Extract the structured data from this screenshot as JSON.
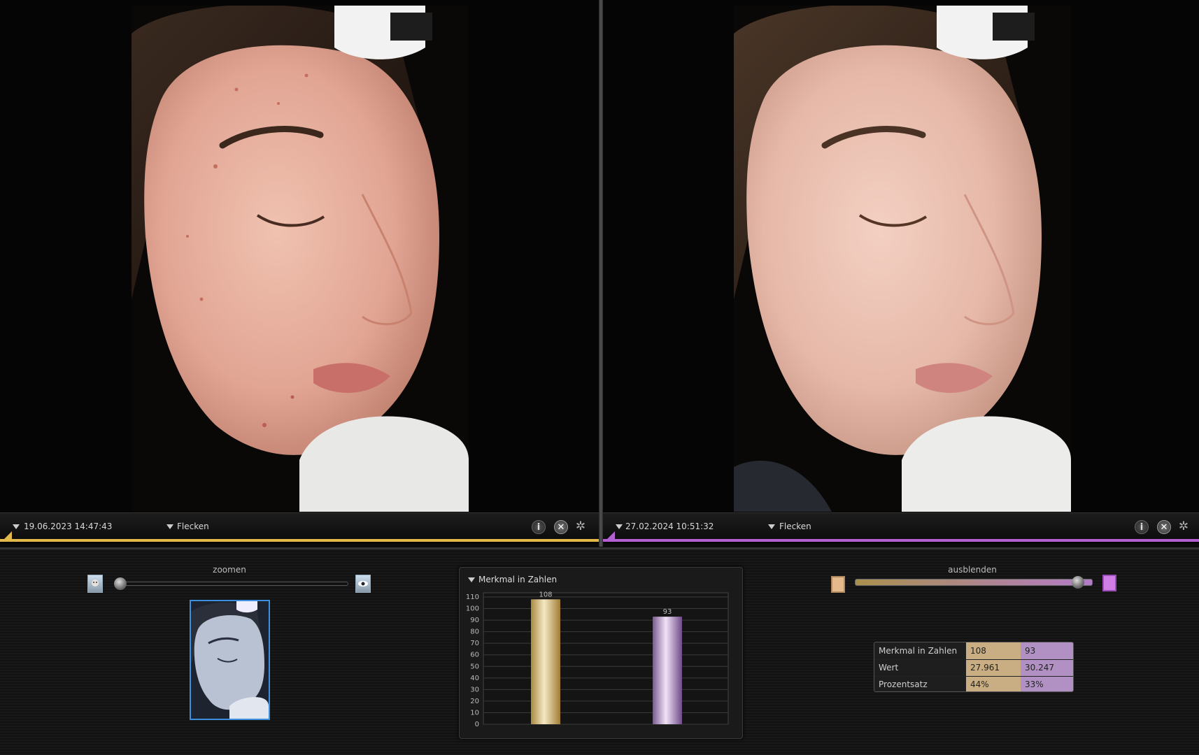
{
  "left_panel": {
    "timestamp": "19.06.2023 14:47:43",
    "feature": "Flecken",
    "accent_color": "#e3b94a",
    "photo_icon": "face-photo-before"
  },
  "right_panel": {
    "timestamp": "27.02.2024 10:51:32",
    "feature": "Flecken",
    "accent_color": "#b45fd2",
    "photo_icon": "face-photo-after"
  },
  "icons": {
    "info": "i",
    "close": "✕",
    "wheel": "✲"
  },
  "zoom": {
    "label": "zoomen",
    "min_icon": "face-icon",
    "max_icon": "eye-icon",
    "value": 0.0
  },
  "blend": {
    "label": "ausblenden",
    "value": 1.0
  },
  "chart_title": "Merkmal in Zahlen",
  "chart_data": {
    "type": "bar",
    "categories": [
      "19.06.2023 14:47:43",
      "27.02.2024 10:51:32"
    ],
    "values": [
      108,
      93
    ],
    "colors": [
      "#c8a85a",
      "#9d74b5"
    ],
    "ylim": [
      0,
      110
    ],
    "yticks": [
      0,
      10,
      20,
      30,
      40,
      50,
      60,
      70,
      80,
      90,
      100,
      110
    ],
    "grid": true,
    "xlabel": "",
    "ylabel": "",
    "title": "Merkmal in Zahlen",
    "data_labels": [
      "108",
      "93"
    ]
  },
  "stats": {
    "rows": [
      {
        "label": "Merkmal in Zahlen",
        "a": "108",
        "b": "93"
      },
      {
        "label": "Wert",
        "a": "27.961",
        "b": "30.247"
      },
      {
        "label": "Prozentsatz",
        "a": "44%",
        "b": "33%"
      }
    ]
  }
}
